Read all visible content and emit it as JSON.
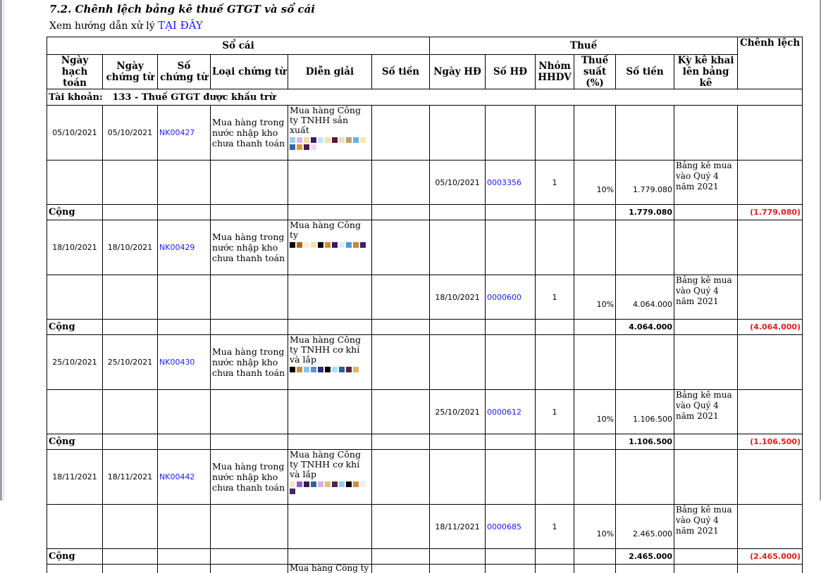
{
  "title": "7.2. Chênh lệch bảng kê thuế GTGT và sổ cái",
  "guide": {
    "text": "Xem hướng dẫn xử lý",
    "link": "TẠI ĐÂY"
  },
  "headers": {
    "ledger_group": "Sổ cái",
    "tax_group": "Thuế",
    "difference": "Chênh lệch",
    "posting_date": "Ngày hạch toán",
    "voucher_date": "Ngày chứng từ",
    "voucher_no": "Số chứng từ",
    "voucher_type": "Loại chứng từ",
    "description": "Diễn giải",
    "ledger_amount": "Số tiền",
    "invoice_date": "Ngày HĐ",
    "invoice_no": "Số HĐ",
    "group": "Nhóm HHDV",
    "tax_rate": "Thuế suất (%)",
    "tax_amount": "Số tiền",
    "declaration": "Kỳ kê khai lên bảng kê"
  },
  "account": {
    "label": "Tài khoản:",
    "value": "133 - Thuế GTGT được khấu trừ"
  },
  "total_label": "Cộng",
  "entries": [
    {
      "posting_date": "05/10/2021",
      "voucher_date": "05/10/2021",
      "voucher_no": "NK00427",
      "voucher_type": "Mua hàng trong nước nhập kho chưa thanh toán",
      "description": "Mua hàng Công ty TNHH sản xuất",
      "invoice_date": "05/10/2021",
      "invoice_no": "0003356",
      "group": "1",
      "tax_rate": "10%",
      "tax_amount": "1.779.080",
      "declaration": "Bảng kê mua vào Quý 4 năm 2021",
      "total": "1.779.080",
      "difference": "(1.779.080)"
    },
    {
      "posting_date": "18/10/2021",
      "voucher_date": "18/10/2021",
      "voucher_no": "NK00429",
      "voucher_type": "Mua hàng trong nước nhập kho chưa thanh toán",
      "description": "Mua hàng Công ty",
      "invoice_date": "18/10/2021",
      "invoice_no": "0000600",
      "group": "1",
      "tax_rate": "10%",
      "tax_amount": "4.064.000",
      "declaration": "Bảng kê mua vào Quý 4 năm 2021",
      "total": "4.064.000",
      "difference": "(4.064.000)"
    },
    {
      "posting_date": "25/10/2021",
      "voucher_date": "25/10/2021",
      "voucher_no": "NK00430",
      "voucher_type": "Mua hàng trong nước nhập kho chưa thanh toán",
      "description": "Mua hàng Công ty TNHH cơ khí và lắp",
      "invoice_date": "25/10/2021",
      "invoice_no": "0000612",
      "group": "1",
      "tax_rate": "10%",
      "tax_amount": "1.106.500",
      "declaration": "Bảng kê mua vào Quý 4 năm 2021",
      "total": "1.106.500",
      "difference": "(1.106.500)"
    },
    {
      "posting_date": "18/11/2021",
      "voucher_date": "18/11/2021",
      "voucher_no": "NK00442",
      "voucher_type": "Mua hàng trong nước nhập kho chưa thanh toán",
      "description": "Mua hàng Công ty TNHH cơ khí và lắp",
      "invoice_date": "18/11/2021",
      "invoice_no": "0000685",
      "group": "1",
      "tax_rate": "10%",
      "tax_amount": "2.465.000",
      "declaration": "Bảng kê mua vào Quý 4 năm 2021",
      "total": "2.465.000",
      "difference": "(2.465.000)"
    }
  ],
  "partial_description": "Mua hàng Công ty",
  "colors": {
    "link": "#1a1aff",
    "negative": "#e02020"
  }
}
